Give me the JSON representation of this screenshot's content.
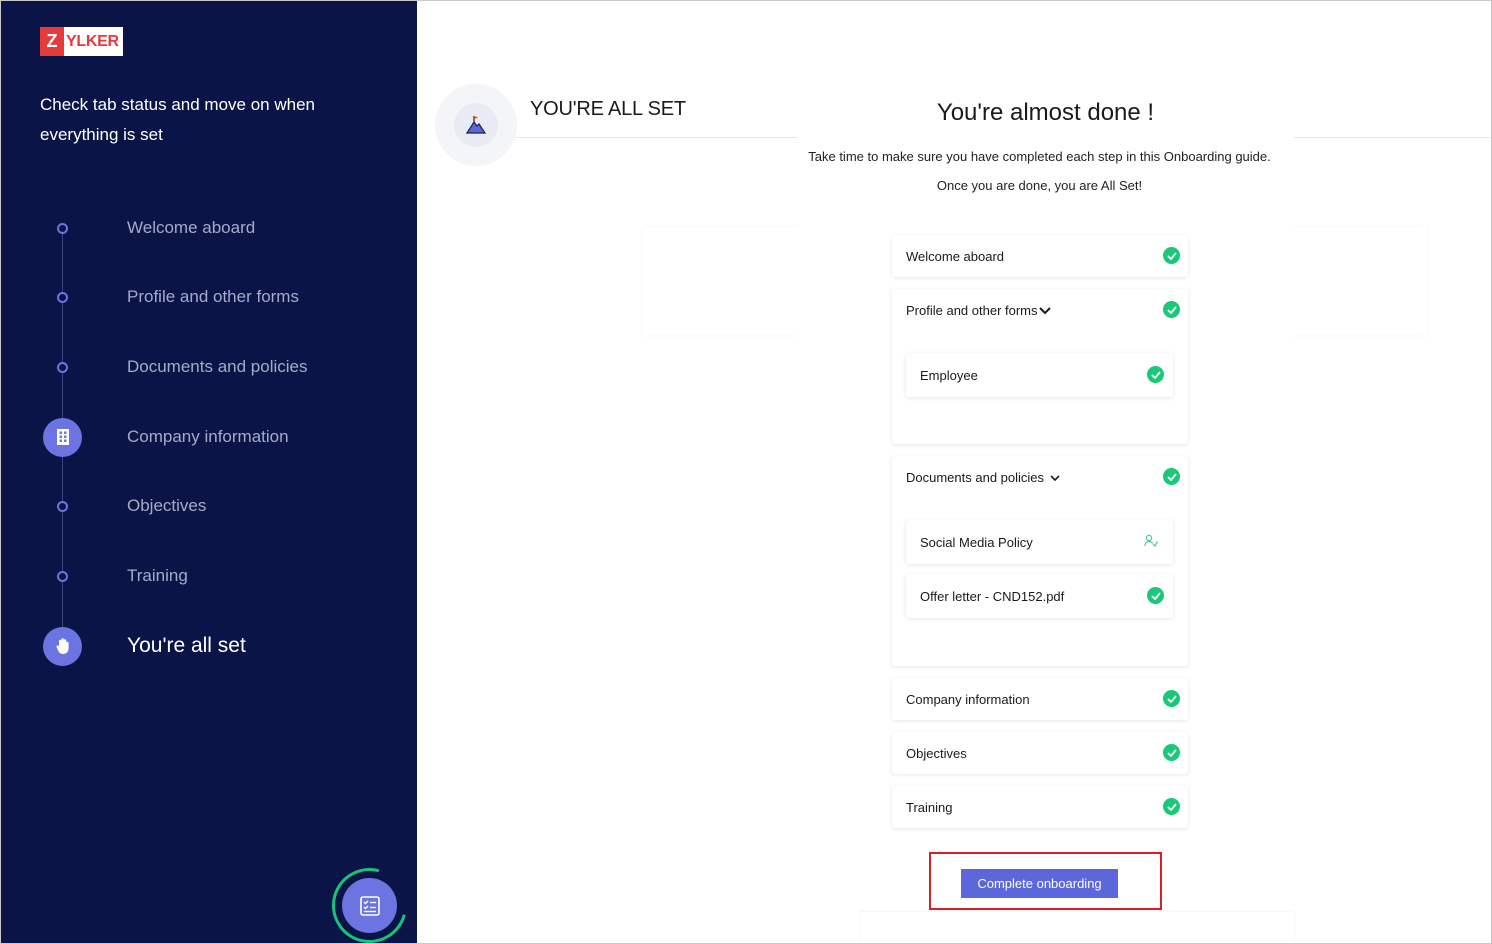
{
  "brand": {
    "logo_letter": "Z",
    "logo_text": "YLKER"
  },
  "sidebar": {
    "heading": "Check tab status and move on when everything is set",
    "steps": [
      {
        "label": "Welcome aboard",
        "icon": "dot"
      },
      {
        "label": "Profile and other forms",
        "icon": "dot"
      },
      {
        "label": "Documents and policies",
        "icon": "dot"
      },
      {
        "label": "Company information",
        "icon": "building-icon"
      },
      {
        "label": "Objectives",
        "icon": "dot"
      },
      {
        "label": "Training",
        "icon": "dot"
      },
      {
        "label": "You're all set",
        "icon": "hand-icon",
        "active": true
      }
    ],
    "fab_icon": "checklist-icon"
  },
  "main": {
    "section_title": "YOU'RE ALL SET",
    "section_icon": "mountain-flag-icon"
  },
  "modal": {
    "title": "You're almost done !",
    "line1": "Take time to make sure you have completed each step in this Onboarding guide.",
    "line2": "Once you are done, you are All Set!",
    "items": {
      "welcome": "Welcome aboard",
      "profile": "Profile and other forms",
      "profile_sub": [
        "Employee"
      ],
      "documents": "Documents and policies",
      "documents_sub": [
        "Social Media Policy",
        "Offer letter - CND152.pdf"
      ],
      "company": "Company information",
      "objectives": "Objectives",
      "training": "Training"
    },
    "complete_button": "Complete onboarding"
  },
  "colors": {
    "sidebar_bg": "#0b1446",
    "accent": "#5c67dc",
    "success": "#19c977",
    "highlight": "#d91f26"
  }
}
